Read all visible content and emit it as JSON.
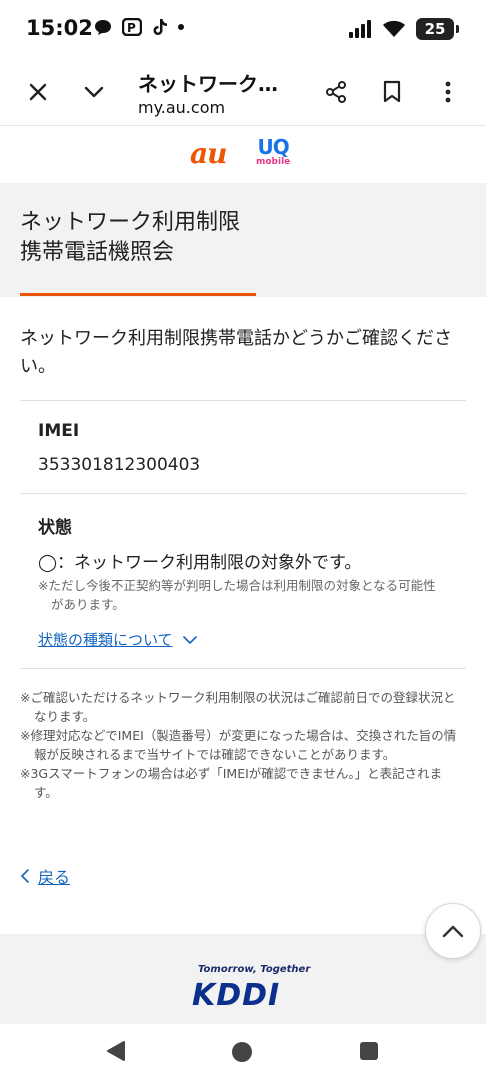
{
  "status_bar": {
    "time": "15:02",
    "battery": "25"
  },
  "browser": {
    "page_title": "ネットワーク…",
    "url": "my.au.com"
  },
  "brands": {
    "au": "au",
    "uq_main": "UQ",
    "uq_sub": "mobile"
  },
  "heading": {
    "line1": "ネットワーク利用制限",
    "line2": "携帯電話機照会"
  },
  "intro": "ネットワーク利用制限携帯電話かどうかご確認ください。",
  "imei": {
    "label": "IMEI",
    "value": "353301812300403"
  },
  "status": {
    "label": "状態",
    "value": "◯：ネットワーク利用制限の対象外です。",
    "note": "※ただし今後不正契約等が判明した場合は利用制限の対象となる可能性があります。",
    "link": "状態の種類について"
  },
  "notes": [
    "※ご確認いただけるネットワーク利用制限の状況はご確認前日での登録状況となります。",
    "※修理対応などでIMEI（製造番号）が変更になった場合は、交換された旨の情報が反映されるまで当サイトでは確認できないことがあります。",
    "※3Gスマートフォンの場合は必ず「IMEIが確認できません。」と表記されます。"
  ],
  "back_link": "戻る",
  "footer": {
    "tagline": "Tomorrow, Together",
    "logo": "KDDI"
  },
  "colors": {
    "accent_orange": "#eb5505",
    "link_blue": "#1565c0",
    "band_gray": "#f2f2f2"
  }
}
